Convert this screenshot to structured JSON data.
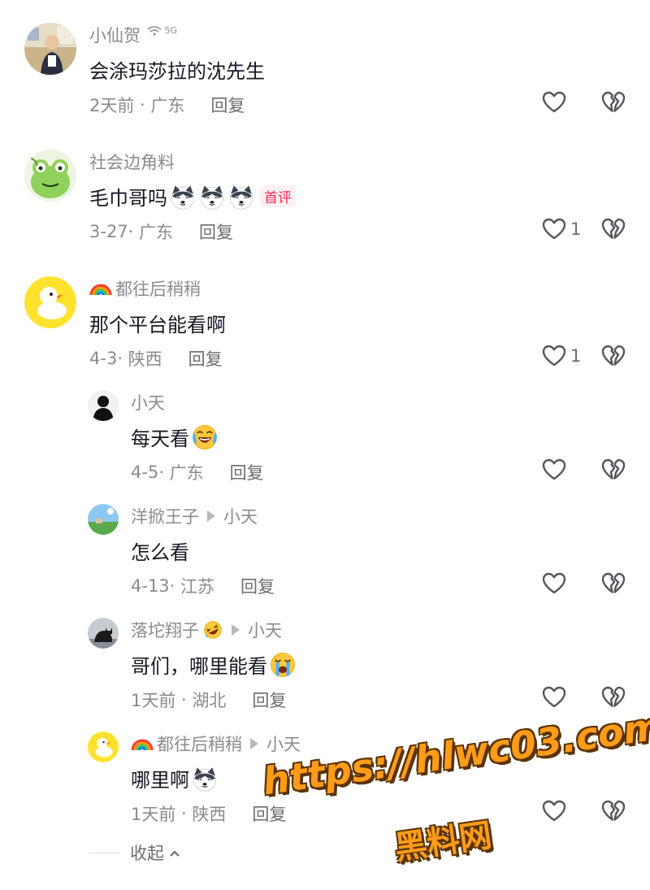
{
  "comments": [
    {
      "username": "小仙贺",
      "signal": "5G",
      "text": "会涂玛莎拉的沈先生",
      "time": "2天前",
      "location": "广东",
      "reply_label": "回复",
      "likes": ""
    },
    {
      "username": "社会边角料",
      "text": "毛巾哥吗",
      "badge": "首评",
      "time": "3-27",
      "location": "广东",
      "reply_label": "回复",
      "likes": "1"
    },
    {
      "username": "都往后稍稍",
      "text": "那个平台能看啊",
      "time": "4-3",
      "location": "陕西",
      "reply_label": "回复",
      "likes": "1",
      "replies": [
        {
          "username": "小天",
          "text": "每天看",
          "time": "4-5",
          "location": "广东",
          "reply_label": "回复"
        },
        {
          "username": "洋掀王子",
          "reply_to": "小天",
          "text": "怎么看",
          "time": "4-13",
          "location": "江苏",
          "reply_label": "回复"
        },
        {
          "username": "落坨翔子",
          "reply_to": "小天",
          "text": "哥们，哪里能看",
          "time": "1天前",
          "location": "湖北",
          "reply_label": "回复"
        },
        {
          "username": "都往后稍稍",
          "reply_to": "小天",
          "text": "哪里啊",
          "time": "1天前",
          "location": "陕西",
          "reply_label": "回复"
        }
      ]
    }
  ],
  "collapse_label": "收起",
  "watermark": {
    "url": "https://hlwc03.com",
    "name": "黑料网"
  },
  "icons": {
    "like": "heart-outline-icon",
    "dislike": "broken-heart-icon",
    "accent": "#fe2c55",
    "watermark_color": "#ff9c1a"
  }
}
